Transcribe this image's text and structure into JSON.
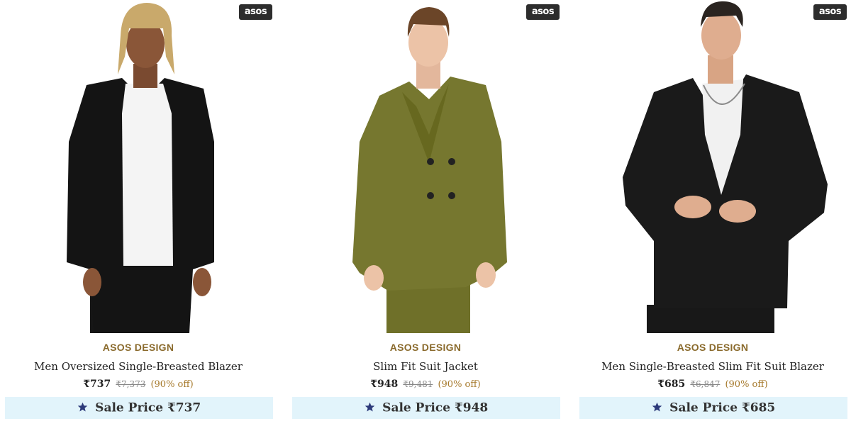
{
  "theme": {
    "brand_color": "#8a6a2c",
    "discount_color": "#a6792b",
    "sale_bar_bg": "#e2f4fb",
    "star_color": "#2c3a7a",
    "logo_bg": "#2d2d2d"
  },
  "products": [
    {
      "logo": "asos",
      "brand": "ASOS DESIGN",
      "name": "Men Oversized Single-Breasted Blazer",
      "price": "₹737",
      "original_price": "₹7,373",
      "discount": "(90% off)",
      "sale_price_label": "Sale Price ₹737",
      "sale_icon": "star-icon",
      "jacket_color": "#141414"
    },
    {
      "logo": "asos",
      "brand": "ASOS DESIGN",
      "name": "Slim Fit Suit Jacket",
      "price": "₹948",
      "original_price": "₹9,481",
      "discount": "(90% off)",
      "sale_price_label": "Sale Price ₹948",
      "sale_icon": "star-icon",
      "jacket_color": "#76772f"
    },
    {
      "logo": "asos",
      "brand": "ASOS DESIGN",
      "name": "Men Single-Breasted Slim Fit Suit Blazer",
      "price": "₹685",
      "original_price": "₹6,847",
      "discount": "(90% off)",
      "sale_price_label": "Sale Price ₹685",
      "sale_icon": "star-icon",
      "jacket_color": "#1a1a1a"
    }
  ]
}
